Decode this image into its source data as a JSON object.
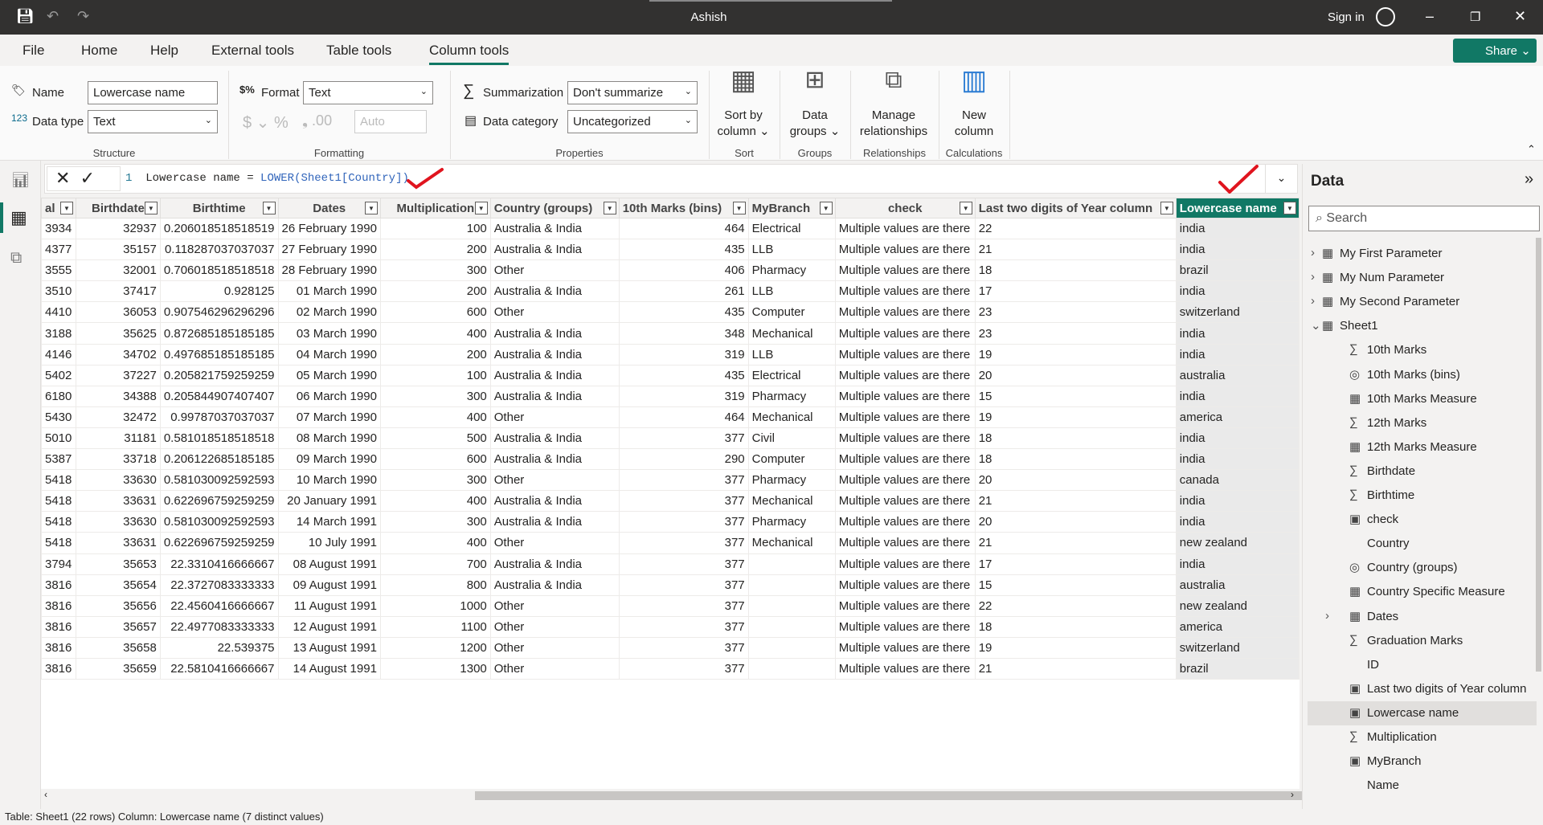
{
  "title": "Ashish",
  "signin": "Sign in",
  "menu": [
    "File",
    "Home",
    "Help",
    "External tools",
    "Table tools",
    "Column tools"
  ],
  "share": "Share",
  "ribbon": {
    "name_label": "Name",
    "name_value": "Lowercase name",
    "datatype_label": "Data type",
    "datatype_value": "Text",
    "format_label": "Format",
    "format_value": "Text",
    "decimals": "Auto",
    "summarization_label": "Summarization",
    "summarization_value": "Don't summarize",
    "category_label": "Data category",
    "category_value": "Uncategorized",
    "sort_by": "Sort by",
    "sort_column": "column",
    "data": "Data",
    "groups": "groups",
    "manage": "Manage",
    "relationships": "relationships",
    "new": "New",
    "column": "column",
    "groups_labels": [
      "Structure",
      "Formatting",
      "Properties",
      "Sort",
      "Groups",
      "Relationships",
      "Calculations"
    ]
  },
  "formula": {
    "line": "1",
    "text": "Lowercase name = ",
    "func": "LOWER",
    "arg": "(Sheet1[Country])"
  },
  "table": {
    "headers": [
      "al",
      "Birthdate",
      "Birthtime",
      "Dates",
      "Multiplication",
      "Country (groups)",
      "10th Marks (bins)",
      "MyBranch",
      "check",
      "Last two digits of Year column",
      "Lowercase name"
    ],
    "rows": [
      [
        "3934",
        "32937",
        "0.206018518518519",
        "26 February 1990",
        "100",
        "Australia & India",
        "464",
        "Electrical",
        "Multiple values are there",
        "22",
        "india"
      ],
      [
        "4377",
        "35157",
        "0.118287037037037",
        "27 February 1990",
        "200",
        "Australia & India",
        "435",
        "LLB",
        "Multiple values are there",
        "21",
        "india"
      ],
      [
        "3555",
        "32001",
        "0.706018518518518",
        "28 February 1990",
        "300",
        "Other",
        "406",
        "Pharmacy",
        "Multiple values are there",
        "18",
        "brazil"
      ],
      [
        "3510",
        "37417",
        "0.928125",
        "01 March 1990",
        "200",
        "Australia & India",
        "261",
        "LLB",
        "Multiple values are there",
        "17",
        "india"
      ],
      [
        "4410",
        "36053",
        "0.907546296296296",
        "02 March 1990",
        "600",
        "Other",
        "435",
        "Computer",
        "Multiple values are there",
        "23",
        "switzerland"
      ],
      [
        "3188",
        "35625",
        "0.872685185185185",
        "03 March 1990",
        "400",
        "Australia & India",
        "348",
        "Mechanical",
        "Multiple values are there",
        "23",
        "india"
      ],
      [
        "4146",
        "34702",
        "0.497685185185185",
        "04 March 1990",
        "200",
        "Australia & India",
        "319",
        "LLB",
        "Multiple values are there",
        "19",
        "india"
      ],
      [
        "5402",
        "37227",
        "0.205821759259259",
        "05 March 1990",
        "100",
        "Australia & India",
        "435",
        "Electrical",
        "Multiple values are there",
        "20",
        "australia"
      ],
      [
        "6180",
        "34388",
        "0.205844907407407",
        "06 March 1990",
        "300",
        "Australia & India",
        "319",
        "Pharmacy",
        "Multiple values are there",
        "15",
        "india"
      ],
      [
        "5430",
        "32472",
        "0.99787037037037",
        "07 March 1990",
        "400",
        "Other",
        "464",
        "Mechanical",
        "Multiple values are there",
        "19",
        "america"
      ],
      [
        "5010",
        "31181",
        "0.581018518518518",
        "08 March 1990",
        "500",
        "Australia & India",
        "377",
        "Civil",
        "Multiple values are there",
        "18",
        "india"
      ],
      [
        "5387",
        "33718",
        "0.206122685185185",
        "09 March 1990",
        "600",
        "Australia & India",
        "290",
        "Computer",
        "Multiple values are there",
        "18",
        "india"
      ],
      [
        "5418",
        "33630",
        "0.581030092592593",
        "10 March 1990",
        "300",
        "Other",
        "377",
        "Pharmacy",
        "Multiple values are there",
        "20",
        "canada"
      ],
      [
        "5418",
        "33631",
        "0.622696759259259",
        "20 January 1991",
        "400",
        "Australia & India",
        "377",
        "Mechanical",
        "Multiple values are there",
        "21",
        "india"
      ],
      [
        "5418",
        "33630",
        "0.581030092592593",
        "14 March 1991",
        "300",
        "Australia & India",
        "377",
        "Pharmacy",
        "Multiple values are there",
        "20",
        "india"
      ],
      [
        "5418",
        "33631",
        "0.622696759259259",
        "10 July 1991",
        "400",
        "Other",
        "377",
        "Mechanical",
        "Multiple values are there",
        "21",
        "new zealand"
      ],
      [
        "3794",
        "35653",
        "22.3310416666667",
        "08 August 1991",
        "700",
        "Australia & India",
        "377",
        "",
        "Multiple values are there",
        "17",
        "india"
      ],
      [
        "3816",
        "35654",
        "22.3727083333333",
        "09 August 1991",
        "800",
        "Australia & India",
        "377",
        "",
        "Multiple values are there",
        "15",
        "australia"
      ],
      [
        "3816",
        "35656",
        "22.4560416666667",
        "11 August 1991",
        "1000",
        "Other",
        "377",
        "",
        "Multiple values are there",
        "22",
        "new zealand"
      ],
      [
        "3816",
        "35657",
        "22.4977083333333",
        "12 August 1991",
        "1100",
        "Other",
        "377",
        "",
        "Multiple values are there",
        "18",
        "america"
      ],
      [
        "3816",
        "35658",
        "22.539375",
        "13 August 1991",
        "1200",
        "Other",
        "377",
        "",
        "Multiple values are there",
        "19",
        "switzerland"
      ],
      [
        "3816",
        "35659",
        "22.5810416666667",
        "14 August 1991",
        "1300",
        "Other",
        "377",
        "",
        "Multiple values are there",
        "21",
        "brazil"
      ]
    ]
  },
  "pane": {
    "title": "Data",
    "search_placeholder": "Search",
    "items": [
      {
        "label": "My First Parameter",
        "icon": "parameter-table-icon",
        "level": 0,
        "expander": "›"
      },
      {
        "label": "My Num Parameter",
        "icon": "parameter-table-icon",
        "level": 0,
        "expander": "›"
      },
      {
        "label": "My Second Parameter",
        "icon": "parameter-table-icon",
        "level": 0,
        "expander": "›"
      },
      {
        "label": "Sheet1",
        "icon": "table-icon",
        "level": 0,
        "expander": "⌄"
      },
      {
        "label": "10th Marks",
        "icon": "sigma-icon",
        "level": 1
      },
      {
        "label": "10th Marks (bins)",
        "icon": "bins-icon",
        "level": 1
      },
      {
        "label": "10th Marks Measure",
        "icon": "measure-icon",
        "level": 1
      },
      {
        "label": "12th Marks",
        "icon": "sigma-icon",
        "level": 1
      },
      {
        "label": "12th Marks Measure",
        "icon": "measure-icon",
        "level": 1
      },
      {
        "label": "Birthdate",
        "icon": "sigma-icon",
        "level": 1
      },
      {
        "label": "Birthtime",
        "icon": "sigma-icon",
        "level": 1
      },
      {
        "label": "check",
        "icon": "calculated-column-icon",
        "level": 1
      },
      {
        "label": "Country",
        "icon": "",
        "level": 1
      },
      {
        "label": "Country (groups)",
        "icon": "bins-icon",
        "level": 1
      },
      {
        "label": "Country Specific Measure",
        "icon": "measure-icon",
        "level": 1
      },
      {
        "label": "Dates",
        "icon": "calendar-icon",
        "level": 1,
        "expander": "›"
      },
      {
        "label": "Graduation Marks",
        "icon": "sigma-icon",
        "level": 1
      },
      {
        "label": "ID",
        "icon": "",
        "level": 1
      },
      {
        "label": "Last two digits of Year column",
        "icon": "calculated-column-icon",
        "level": 1
      },
      {
        "label": "Lowercase name",
        "icon": "calculated-column-icon",
        "level": 1,
        "selected": true
      },
      {
        "label": "Multiplication",
        "icon": "sigma-icon",
        "level": 1
      },
      {
        "label": "MyBranch",
        "icon": "calculated-column-icon",
        "level": 1
      },
      {
        "label": "Name",
        "icon": "",
        "level": 1
      }
    ]
  },
  "status": "Table: Sheet1 (22 rows) Column: Lowercase name (7 distinct values)",
  "colors": {
    "accent": "#117865",
    "annotation": "#e0141e"
  }
}
